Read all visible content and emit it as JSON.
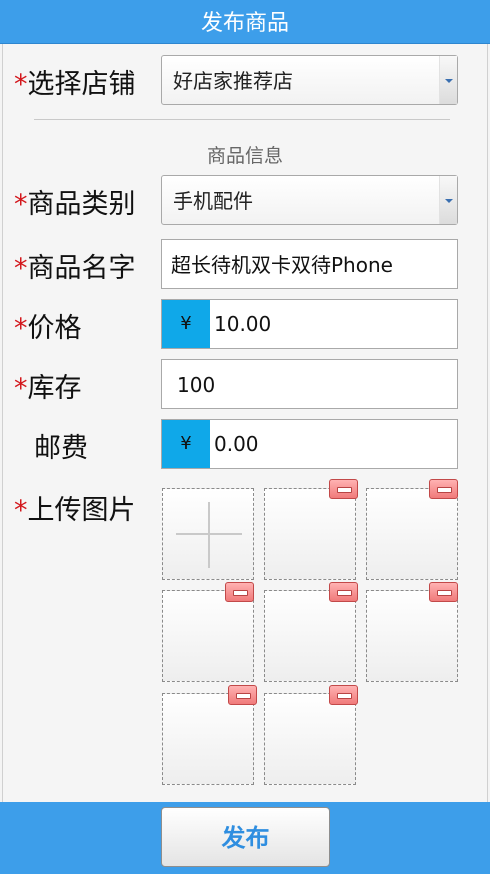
{
  "header": {
    "title": "发布商品"
  },
  "form": {
    "required_mark": "*",
    "store": {
      "label": "选择店铺",
      "value": "好店家推荐店"
    },
    "section_title": "商品信息",
    "category": {
      "label": "商品类别",
      "value": "手机配件"
    },
    "name": {
      "label": "商品名字",
      "value": "超长待机双卡双待Phone"
    },
    "price": {
      "label": "价格",
      "currency": "¥",
      "value": "10.00"
    },
    "stock": {
      "label": "库存",
      "value": "100"
    },
    "shipping": {
      "label": "邮费",
      "currency": "¥",
      "value": "0.00"
    },
    "images": {
      "label": "上传图片",
      "uploaded_count": 7,
      "add_slot_icon": "plus-icon",
      "remove_icon": "minus-icon"
    }
  },
  "footer": {
    "submit_label": "发布"
  },
  "colors": {
    "primary": "#3d9eea",
    "currency_badge": "#0fa8e9",
    "required": "#d3171c",
    "remove": "#f07a7a"
  }
}
